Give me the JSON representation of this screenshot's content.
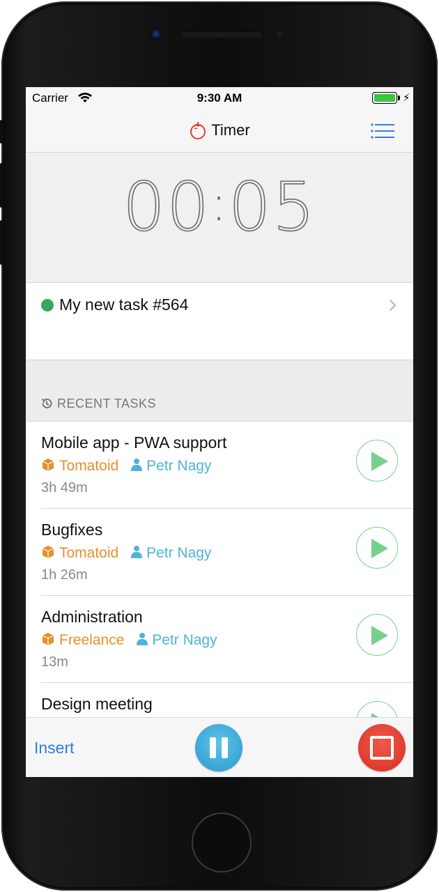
{
  "status_bar": {
    "carrier": "Carrier",
    "time": "9:30 AM",
    "battery_color": "#3cc63c"
  },
  "nav": {
    "title": "Timer",
    "logo_icon": "tomato-icon",
    "menu_icon": "list-icon"
  },
  "timer": {
    "minutes": "00",
    "separator": ":",
    "seconds": "05"
  },
  "current_task": {
    "name": "My new task #564",
    "status_color": "#3aa75a"
  },
  "recent": {
    "header": "RECENT TASKS",
    "header_icon": "history-icon",
    "items": [
      {
        "title": "Mobile app - PWA support",
        "project": "Tomatoid",
        "user": "Petr Nagy",
        "duration": "3h 49m"
      },
      {
        "title": "Bugfixes",
        "project": "Tomatoid",
        "user": "Petr Nagy",
        "duration": "1h 26m"
      },
      {
        "title": "Administration",
        "project": "Freelance",
        "user": "Petr Nagy",
        "duration": "13m"
      },
      {
        "title": "Design meeting",
        "project": "",
        "user": "",
        "duration": ""
      }
    ]
  },
  "toolbar": {
    "insert_label": "Insert",
    "pause_color": "#3aa6d6",
    "stop_color": "#e03c2e"
  },
  "colors": {
    "accent_blue": "#2d7fe0",
    "project_orange": "#e6902a",
    "user_blue": "#4fb3d9",
    "play_green": "#78d08e"
  }
}
